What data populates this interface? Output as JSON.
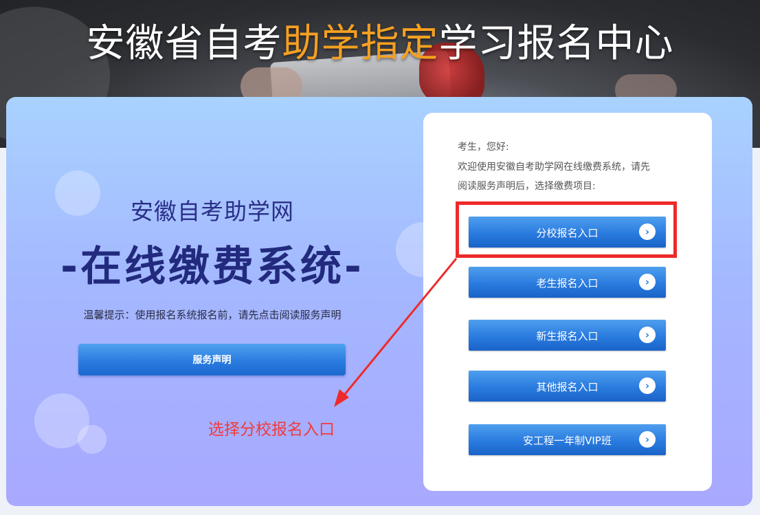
{
  "hero": {
    "title_pre": "安徽省自考",
    "title_highlight": "助学指定",
    "title_post": "学习报名中心",
    "highlight_color": "#f5a021"
  },
  "left": {
    "site_name": "安徽自考助学网",
    "system_name": "-在线缴费系统-",
    "tip": "温馨提示：使用报名系统报名前，请先点击阅读服务声明",
    "statement_button": "服务声明"
  },
  "annotation": {
    "hint": "选择分校报名入口",
    "color": "#ee2a2a"
  },
  "card": {
    "greeting_lines": [
      "考生，您好:",
      "欢迎使用安徽自考助学网在线缴费系统，请先",
      "阅读服务声明后，选择缴费项目:"
    ],
    "entries": [
      {
        "label": "分校报名入口",
        "icon": "chevron-right-icon"
      },
      {
        "label": "老生报名入口",
        "icon": "chevron-right-icon"
      },
      {
        "label": "新生报名入口",
        "icon": "chevron-right-icon"
      },
      {
        "label": "其他报名入口",
        "icon": "chevron-right-icon"
      },
      {
        "label": "安工程一年制VIP班",
        "icon": "chevron-right-icon"
      }
    ]
  },
  "colors": {
    "button_blue": "#2a7bdf",
    "title_navy": "#222a7e"
  }
}
